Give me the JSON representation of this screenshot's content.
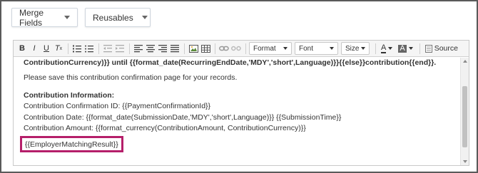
{
  "top_buttons": {
    "merge_fields": "Merge Fields",
    "reusables": "Reusables"
  },
  "toolbar": {
    "format_label": "Format",
    "font_label": "Font",
    "size_label": "Size",
    "source_label": "Source",
    "icons": [
      "bold-icon",
      "italic-icon",
      "underline-icon",
      "clear-format-icon",
      "numbered-list-icon",
      "bulleted-list-icon",
      "outdent-icon",
      "indent-icon",
      "align-left-icon",
      "align-center-icon",
      "align-right-icon",
      "justify-icon",
      "image-icon",
      "table-icon",
      "link-icon",
      "unlink-icon",
      "text-color-icon",
      "background-color-icon",
      "source-icon"
    ]
  },
  "content": {
    "line1": "ContributionCurrency)}} until {{format_date(RecurringEndDate,'MDY','short',Language)}}{{else}}contribution{{end}}.",
    "line2": "Please save this contribution confirmation page for your records.",
    "line3": "Contribution Information:",
    "line4": "Contribution Confirmation ID: {{PaymentConfirmationId}}",
    "line5": "Contribution Date: {{format_date(SubmissionDate,'MDY','short',Language)}} {{SubmissionTime}}",
    "line6": "Contribution Amount: {{format_currency(ContributionAmount, ContributionCurrency)}}",
    "highlighted": "{{EmployerMatchingResult}}"
  },
  "colors": {
    "highlight_border": "#b51f6a"
  }
}
